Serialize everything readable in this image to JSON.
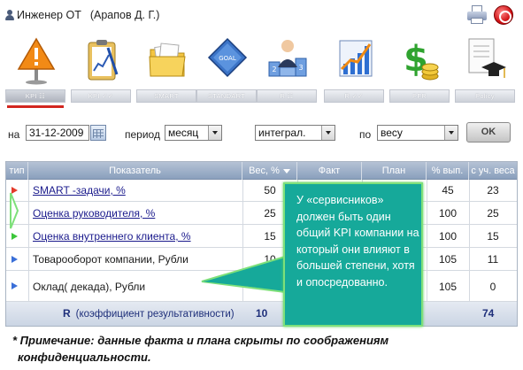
{
  "header": {
    "title": "Инженер ОТ",
    "subtitle": "(Арапов Д. Г.)"
  },
  "toolbar": {
    "tools": [
      {
        "label": "KPI ☷",
        "icon": "warning-sign-icon",
        "active": true
      },
      {
        "label": "KPI ✓✓",
        "icon": "clipboard-chart-icon",
        "active": false
      },
      {
        "label": "SMART",
        "icon": "folder-icon",
        "active": false
      },
      {
        "label": "STANDART",
        "icon": "goal-diamond-icon",
        "active": false
      },
      {
        "label": "R ☷",
        "icon": "ranking-person-icon",
        "active": false
      },
      {
        "label": "R ✓✓",
        "icon": "growth-chart-icon",
        "active": false
      },
      {
        "label": "PFR",
        "icon": "dollar-coins-icon",
        "active": false
      },
      {
        "label": "Policy",
        "icon": "diploma-cap-icon",
        "active": false
      }
    ]
  },
  "filters": {
    "date_prefix": "на",
    "date_value": "31-12-2009",
    "period_label": "период",
    "period_value": "месяц",
    "mode_value": "интеграл.",
    "by_label": "по",
    "by_value": "весу",
    "ok_label": "OK"
  },
  "table": {
    "columns": [
      "тип",
      "Показатель",
      "Вес, %",
      "Факт",
      "План",
      "% вып.",
      "с уч. веса"
    ],
    "rows": [
      {
        "flag": "red",
        "name": "SMART -задачи, %",
        "link": true,
        "weight": "50",
        "fact": "",
        "plan": "",
        "pct": "45",
        "weighted": "23"
      },
      {
        "flag": "green",
        "name": "Оценка руководителя, %",
        "link": true,
        "weight": "25",
        "fact": "",
        "plan": "",
        "pct": "100",
        "weighted": "25"
      },
      {
        "flag": "green",
        "name": "Оценка внутреннего клиента, %",
        "link": true,
        "weight": "15",
        "fact": "",
        "plan": "",
        "pct": "100",
        "weighted": "15"
      },
      {
        "flag": "blue",
        "name": "Товарооборот компании, Рубли",
        "link": false,
        "weight": "10",
        "fact": "",
        "plan": "",
        "pct": "105",
        "weighted": "11"
      },
      {
        "flag": "blue",
        "name": "Оклад( декада), Рубли",
        "link": false,
        "weight": "",
        "fact": "",
        "plan": "",
        "pct": "105",
        "weighted": "0"
      }
    ],
    "total": {
      "label_r": "R",
      "label": "(коэффициент результативности)",
      "weight": "10",
      "weighted": "74"
    }
  },
  "callout": {
    "text": "У «сервисников» должен быть один общий KPI компании на который они влияют в большей степени, хотя и опосредованно."
  },
  "note": {
    "line1": "* Примечание: данные факта и плана скрыты по соображениям",
    "line2": "конфиденциальности."
  },
  "colors": {
    "header_grad_top": "#b5c2d5",
    "header_grad_bottom": "#8aa0bd",
    "callout_bg": "#16a99a",
    "callout_border": "#7ee07a",
    "active_tab_underline": "#d2261f",
    "flag_red": "#e43a2a",
    "flag_green": "#3cc63a",
    "flag_blue": "#3a6fd8"
  }
}
